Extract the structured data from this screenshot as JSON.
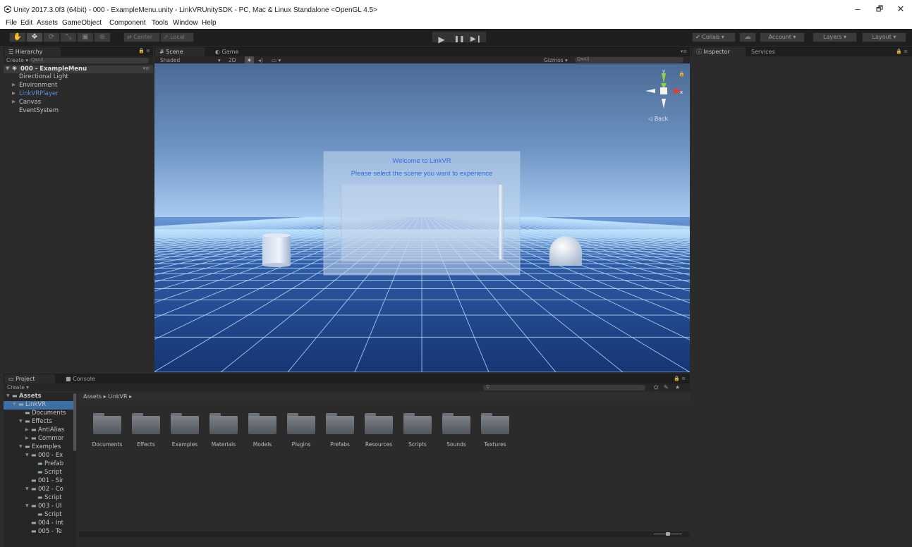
{
  "window": {
    "title": "Unity 2017.3.0f3 (64bit) - 000 - ExampleMenu.unity - LinkVRUnitySDK - PC, Mac & Linux Standalone <OpenGL 4.5>",
    "minimize": "–",
    "maximize": "🗗",
    "close": "✕"
  },
  "menu": [
    "File",
    "Edit",
    "Assets",
    "GameObject",
    "Component",
    "Tools",
    "Window",
    "Help"
  ],
  "toolbar": {
    "tools": [
      "✋",
      "✥",
      "⟳",
      "⤡",
      "▣",
      "⊛"
    ],
    "pivot": "Center",
    "space": "Local",
    "play": "▶",
    "pause": "❚❚",
    "step": "▶❙",
    "collab": "Collab ▾",
    "cloud": "☁",
    "account": "Account ▾",
    "layers": "Layers ▾",
    "layout": "Layout ▾"
  },
  "hierarchy": {
    "tab": "Hierarchy",
    "create": "Create ▾",
    "search": "Q▾All",
    "scene": "000 - ExampleMenu",
    "items": [
      {
        "label": "Directional Light",
        "arrow": ""
      },
      {
        "label": "Environment",
        "arrow": "▶"
      },
      {
        "label": "LinkVRPlayer",
        "arrow": "▶"
      },
      {
        "label": "Canvas",
        "arrow": "▶"
      },
      {
        "label": "EventSystem",
        "arrow": ""
      }
    ]
  },
  "scene": {
    "tab_scene": "Scene",
    "tab_game": "Game",
    "shading": "Shaded",
    "mode2d": "2D",
    "gizmos": "Gizmos ▾",
    "search": "Q▾All",
    "gizmo_back": "◁ Back",
    "welcome_title": "Welcome to LinkVR",
    "welcome_subtitle": "Please select the scene you want to experience"
  },
  "inspector": {
    "tab": "Inspector",
    "services": "Services"
  },
  "project": {
    "tab": "Project",
    "console": "Console",
    "create": "Create ▾",
    "breadcrumb": "Assets ▸ LinkVR ▸",
    "tree": [
      {
        "label": "Assets",
        "depth": 0,
        "arrow": "▼",
        "bold": true
      },
      {
        "label": "LinkVR",
        "depth": 1,
        "arrow": "▼",
        "selected": true
      },
      {
        "label": "Documents",
        "depth": 2,
        "arrow": ""
      },
      {
        "label": "Effects",
        "depth": 2,
        "arrow": "▼"
      },
      {
        "label": "AntiAlias",
        "depth": 3,
        "arrow": "▶"
      },
      {
        "label": "Commor",
        "depth": 3,
        "arrow": "▶"
      },
      {
        "label": "Examples",
        "depth": 2,
        "arrow": "▼"
      },
      {
        "label": "000 - Ex",
        "depth": 3,
        "arrow": "▼"
      },
      {
        "label": "Prefab",
        "depth": 4,
        "arrow": ""
      },
      {
        "label": "Script",
        "depth": 4,
        "arrow": ""
      },
      {
        "label": "001 - Sir",
        "depth": 3,
        "arrow": ""
      },
      {
        "label": "002 - Co",
        "depth": 3,
        "arrow": "▼"
      },
      {
        "label": "Script",
        "depth": 4,
        "arrow": ""
      },
      {
        "label": "003 - UI",
        "depth": 3,
        "arrow": "▼"
      },
      {
        "label": "Script",
        "depth": 4,
        "arrow": ""
      },
      {
        "label": "004 - Int",
        "depth": 3,
        "arrow": ""
      },
      {
        "label": "005 - Te",
        "depth": 3,
        "arrow": ""
      }
    ],
    "folders": [
      "Documents",
      "Effects",
      "Examples",
      "Materials",
      "Models",
      "Plugins",
      "Prefabs",
      "Resources",
      "Scripts",
      "Sounds",
      "Textures"
    ]
  },
  "colors": {
    "panel": "#2b2b2b",
    "toolbar": "#1e1e1e",
    "selection": "#3d6fa6",
    "link_text": "#5b8fd8",
    "welcome_text": "#2f6fe0"
  }
}
